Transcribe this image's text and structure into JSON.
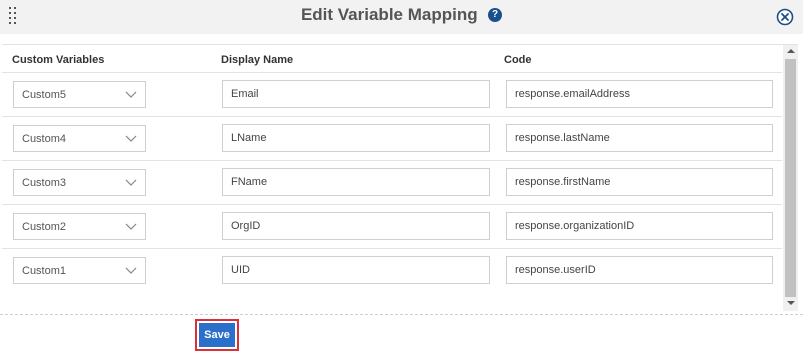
{
  "dialog": {
    "title": "Edit Variable Mapping",
    "help_glyph": "?"
  },
  "columns": {
    "custom": "Custom Variables",
    "display": "Display Name",
    "code": "Code"
  },
  "rows": [
    {
      "custom": "Custom5",
      "display": "Email",
      "code": "response.emailAddress"
    },
    {
      "custom": "Custom4",
      "display": "LName",
      "code": "response.lastName"
    },
    {
      "custom": "Custom3",
      "display": "FName",
      "code": "response.firstName"
    },
    {
      "custom": "Custom2",
      "display": "OrgID",
      "code": "response.organizationID"
    },
    {
      "custom": "Custom1",
      "display": "UID",
      "code": "response.userID"
    }
  ],
  "footer": {
    "save_label": "Save"
  },
  "icons": {
    "drag": "drag-handle-icon",
    "help": "help-circle-icon",
    "close": "close-circle-icon",
    "chevron": "chevron-down-icon"
  },
  "colors": {
    "help_icon": "#1a4f8c",
    "save_button": "#2a6fc9",
    "highlight_border": "#d9303a",
    "header_bg": "#f2f2f2"
  }
}
